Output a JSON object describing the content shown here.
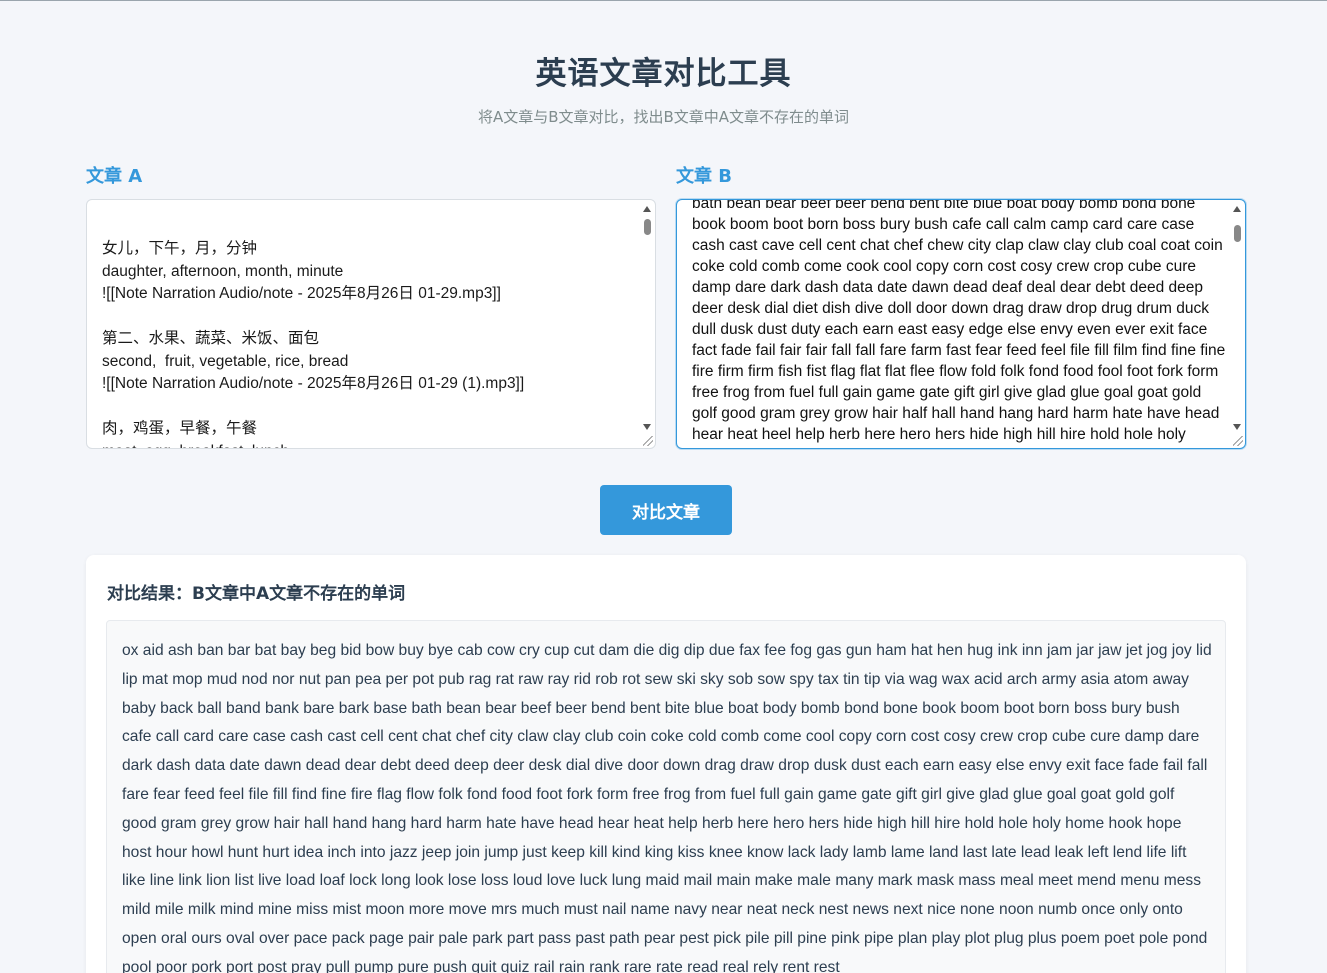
{
  "header": {
    "title": "英语文章对比工具",
    "subtitle": "将A文章与B文章对比，找出B文章中A文章不存在的单词"
  },
  "article_a": {
    "label": "文章 A",
    "content": "女儿，下午，月，分钟\ndaughter, afternoon, month, minute\n![[Note Narration Audio/note - 2025年8月26日 01-29.mp3]]\n\n第二、水果、蔬菜、米饭、面包\nsecond,  fruit, vegetable, rice, bread\n![[Note Narration Audio/note - 2025年8月26日 01-29 (1).mp3]]\n\n肉，鸡蛋，早餐，午餐\nmeat, egg, breakfast, lunch"
  },
  "article_b": {
    "label": "文章 B",
    "content": "bath bean bear beef beer bend bent bite blue boat body bomb bond bone book boom boot born boss bury bush cafe call calm camp card care case cash cast cave cell cent chat chef chew city clap claw clay club coal coat coin coke cold comb come cook cool copy corn cost cosy crew crop cube cure damp dare dark dash data date dawn dead deaf deal dear debt deed deep deer desk dial diet dish dive doll door down drag draw drop drug drum duck dull dusk dust duty each earn east easy edge else envy even ever exit face fact fade fail fair fair fall fall fare farm fast fear feed feel file fill film find fine fine fire firm firm fish fist flag flat flat flee flow fold folk fond food fool foot fork form free frog from fuel full gain game gate gift girl give glad glue goal goat gold golf good gram grey grow hair half hall hand hang hard harm hate have head hear heat heel help herb here hero hers hide high hill hire hold hole holy home hook hope host hour howl huge hunt hurt idea inch into iron jazz jeep"
  },
  "compare_button": {
    "label": "对比文章"
  },
  "result": {
    "title": "对比结果：B文章中A文章不存在的单词",
    "text": "ox aid ash ban bar bat bay beg bid bow buy bye cab cow cry cup cut dam die dig dip due fax fee fog gas gun ham hat hen hug ink inn jam jar jaw jet jog joy lid lip mat mop mud nod nor nut pan pea per pot pub rag rat raw ray rid rob rot sew ski sky sob sow spy tax tin tip via wag wax acid arch army asia atom away baby back ball band bank bare bark base bath bean bear beef beer bend bent bite blue boat body bomb bond bone book boom boot born boss bury bush cafe call card care case cash cast cell cent chat chef city claw clay club coin coke cold comb come cool copy corn cost cosy crew crop cube cure damp dare dark dash data date dawn dead dear debt deed deep deer desk dial dive door down drag draw drop dusk dust each earn easy else envy exit face fade fail fall fare fear feed feel file fill find fine fire flag flow folk fond food foot fork form free frog from fuel full gain game gate gift girl give glad glue goal goat gold golf good gram grey grow hair hall hand hang hard harm hate have head hear heat help herb here hero hers hide high hill hire hold hole holy home hook hope host hour howl hunt hurt idea inch into jazz jeep join jump just keep kill kind king kiss knee know lack lady lamb lame land last late lead leak left lend life lift like line link lion list live load loaf lock long look lose loss loud love luck lung maid mail main make male many mark mask mass meal meet mend menu mess mild mile milk mind mine miss mist moon more move mrs much must nail name navy near neat neck nest news next nice none noon numb once only onto open oral ours oval over pace pack page pair pale park part pass past path pear pest pick pile pill pine pink pipe plan play plot plug plus poem poet pole pond pool poor pork port post pray pull pump pure push quit quiz rail rain rank rare rate read real rely rent rest"
  },
  "colors": {
    "accent": "#3498db",
    "title": "#2c3e50",
    "subtitle": "#7f8c8d",
    "background": "#f4f6fa"
  }
}
